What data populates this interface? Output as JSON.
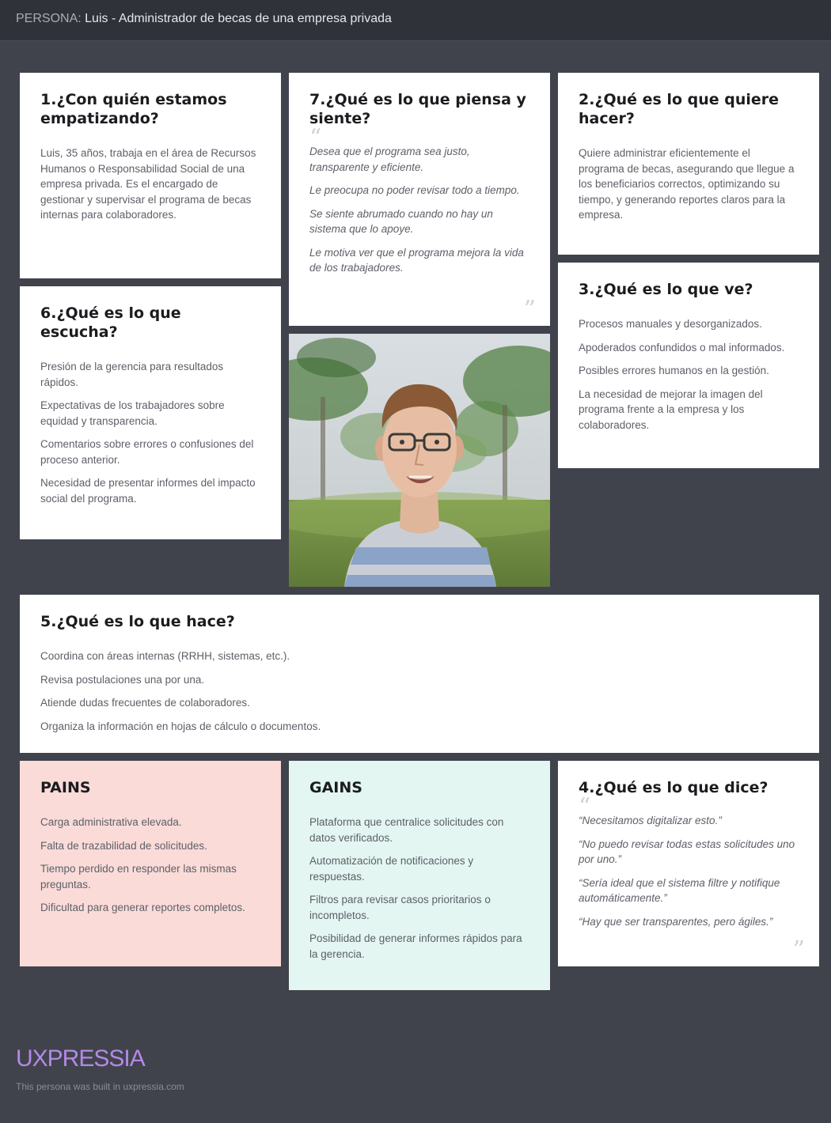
{
  "header": {
    "prefix": "PERSONA:",
    "title": "Luis - Administrador de becas de una empresa privada"
  },
  "cards": {
    "who": {
      "title": "1.¿Con quién estamos empatizando?",
      "items": [
        "Luis, 35 años, trabaja en el área de Recursos Humanos o Responsabilidad Social de una empresa privada. Es el encargado de gestionar y supervisar el programa de becas internas para colaboradores."
      ]
    },
    "thinks": {
      "title": "7.¿Qué es lo que piensa y siente?",
      "items": [
        "Desea que el programa sea justo, transparente y eficiente.",
        "Le preocupa no poder revisar todo a tiempo.",
        "Se siente abrumado cuando no hay un sistema que lo apoye.",
        "Le motiva ver que el programa mejora la vida de los trabajadores."
      ]
    },
    "wants": {
      "title": "2.¿Qué es lo que quiere hacer?",
      "items": [
        "Quiere administrar eficientemente el programa de becas, asegurando que llegue a los beneficiarios correctos, optimizando su tiempo, y generando reportes claros para la empresa."
      ]
    },
    "sees": {
      "title": "3.¿Qué es lo que ve?",
      "items": [
        "Procesos manuales y desorganizados.",
        "Apoderados confundidos o mal informados.",
        "Posibles errores humanos en la gestión.",
        "La necesidad de mejorar la imagen del programa frente a la empresa y los colaboradores."
      ]
    },
    "hears": {
      "title": "6.¿Qué es lo que escucha?",
      "items": [
        "Presión de la gerencia para resultados rápidos.",
        "Expectativas de los trabajadores sobre equidad y transparencia.",
        "Comentarios sobre errores o confusiones del proceso anterior.",
        "Necesidad de presentar informes del impacto social del programa."
      ]
    },
    "does": {
      "title": "5.¿Qué es lo que hace?",
      "items": [
        "Coordina con áreas internas (RRHH, sistemas, etc.).",
        "Revisa postulaciones una por una.",
        "Atiende dudas frecuentes de colaboradores.",
        "Organiza la información en hojas de cálculo o documentos."
      ]
    },
    "pains": {
      "title": "PAINS",
      "items": [
        "Carga administrativa elevada.",
        "Falta de trazabilidad de solicitudes.",
        "Tiempo perdido en responder las mismas preguntas.",
        "Dificultad para generar reportes completos."
      ]
    },
    "gains": {
      "title": "GAINS",
      "items": [
        "Plataforma que centralice solicitudes con datos verificados.",
        "Automatización de notificaciones y respuestas.",
        "Filtros para revisar casos prioritarios o incompletos.",
        "Posibilidad de generar informes rápidos para la gerencia."
      ]
    },
    "says": {
      "title": "4.¿Qué es lo que dice?",
      "items": [
        "“Necesitamos digitalizar esto.”",
        "“No puedo revisar todas estas solicitudes uno por uno.”",
        "“Sería ideal que el sistema filtre y notifique automáticamente.”",
        "“Hay que ser transparentes, pero ágiles.”"
      ]
    }
  },
  "footer": {
    "logo": "UXPRESSIA",
    "note": "This persona was built in uxpressia.com"
  },
  "colors": {
    "background": "#40434c",
    "header": "#2f3239",
    "pains": "#fadbd8",
    "gains": "#e3f6f2",
    "logo": "#b389e6"
  },
  "icons": [
    "quote-open-icon",
    "quote-close-icon"
  ]
}
